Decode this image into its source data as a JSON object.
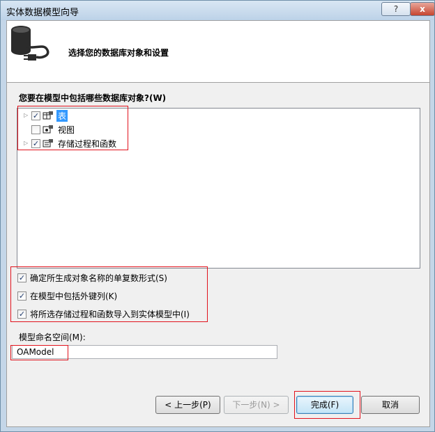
{
  "window": {
    "title": "实体数据模型向导",
    "help_glyph": "?",
    "close_glyph": "x"
  },
  "header": {
    "title": "选择您的数据库对象和设置"
  },
  "objects": {
    "label": "您要在模型中包括哪些数据库对象?(W)",
    "items": [
      {
        "label": "表",
        "checked": true,
        "expandable": true,
        "selected": true
      },
      {
        "label": "视图",
        "checked": false,
        "expandable": false,
        "selected": false
      },
      {
        "label": "存储过程和函数",
        "checked": true,
        "expandable": true,
        "selected": false
      }
    ]
  },
  "options": [
    {
      "label": "确定所生成对象名称的单复数形式(S)",
      "checked": true
    },
    {
      "label": "在模型中包括外键列(K)",
      "checked": true
    },
    {
      "label": "将所选存储过程和函数导入到实体模型中(I)",
      "checked": true
    }
  ],
  "namespace": {
    "label": "模型命名空间(M):",
    "value": "OAModel"
  },
  "buttons": {
    "prev": "< 上一步(P)",
    "next": "下一步(N) >",
    "finish": "完成(F)",
    "cancel": "取消"
  },
  "colors": {
    "highlight": "#e1121c",
    "selection": "#3399ff"
  }
}
